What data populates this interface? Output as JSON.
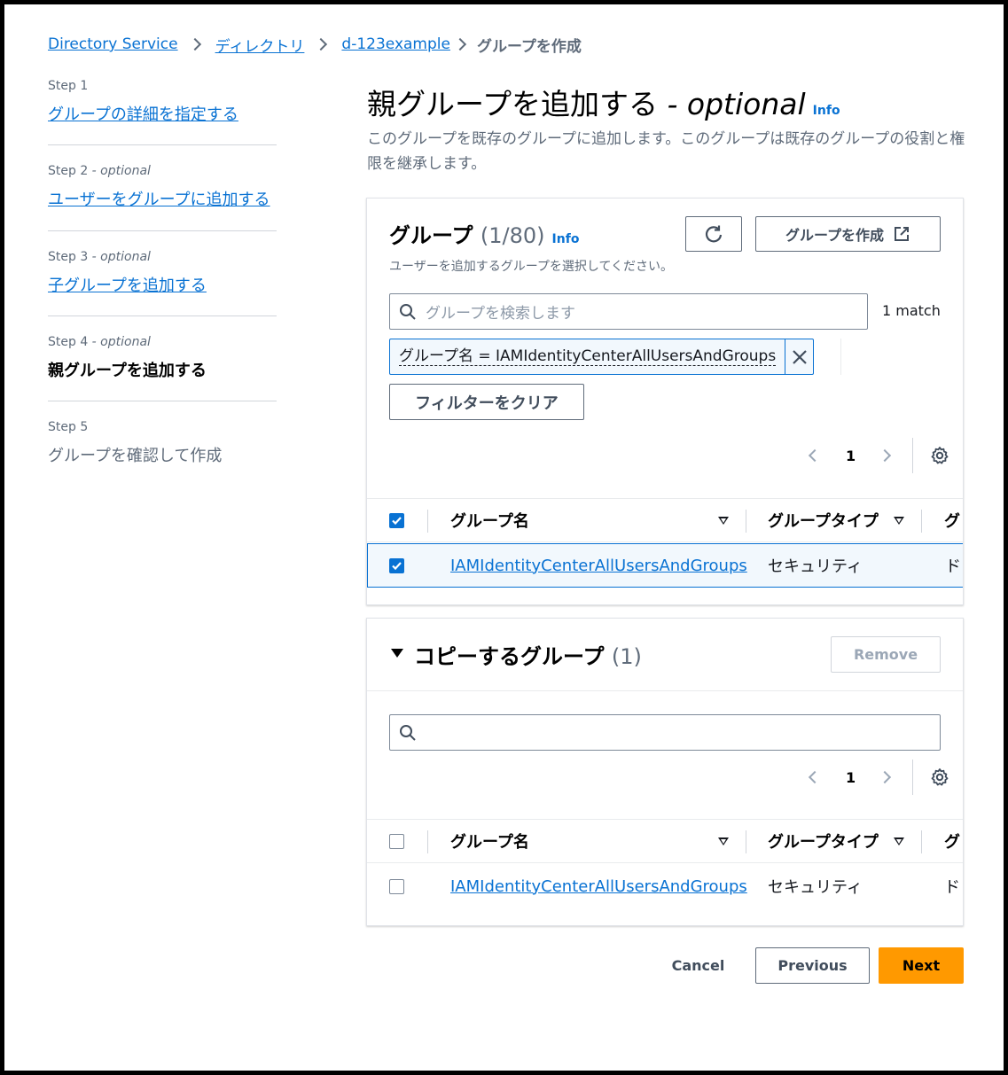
{
  "breadcrumb": [
    "Directory Service",
    "ディレクトリ",
    "d-123example",
    "グループを作成"
  ],
  "steps": [
    {
      "label": "Step 1",
      "optional": "",
      "text": "グループの詳細を指定する"
    },
    {
      "label": "Step 2",
      "optional": " - optional",
      "text": "ユーザーをグループに追加する"
    },
    {
      "label": "Step 3",
      "optional": " - optional",
      "text": "子グループを追加する"
    },
    {
      "label": "Step 4",
      "optional": " - optional",
      "text": "親グループを追加する"
    },
    {
      "label": "Step 5",
      "optional": "",
      "text": "グループを確認して作成"
    }
  ],
  "page": {
    "title": "親グループを追加する",
    "title_suffix": " - optional",
    "info": "Info",
    "description": "このグループを既存のグループに追加します。このグループは既存のグループの役割と権限を継承します。"
  },
  "groups_panel": {
    "title": "グループ",
    "count": "(1/80)",
    "info": "Info",
    "subtitle": "ユーザーを追加するグループを選択してください。",
    "create_button": "グループを作成",
    "search_placeholder": "グループを検索します",
    "match_count": "1 match",
    "filter_token": "グループ名 = IAMIdentityCenterAllUsersAndGroups",
    "clear_filter": "フィルターをクリア",
    "page": "1",
    "columns": [
      "グループ名",
      "グループタイプ",
      "グ"
    ],
    "rows": [
      {
        "name": "IAMIdentityCenterAllUsersAndGroups",
        "type": "セキュリティ",
        "extra": "ド",
        "checked": true
      }
    ]
  },
  "copy_panel": {
    "title": "コピーするグループ",
    "count": "(1)",
    "remove_button": "Remove",
    "search_placeholder": "",
    "page": "1",
    "columns": [
      "グループ名",
      "グループタイプ",
      "グ"
    ],
    "rows": [
      {
        "name": "IAMIdentityCenterAllUsersAndGroups",
        "type": "セキュリティ",
        "extra": "ド",
        "checked": false
      }
    ]
  },
  "footer": {
    "cancel": "Cancel",
    "previous": "Previous",
    "next": "Next"
  },
  "colors": {
    "link": "#0972d3",
    "primary": "#ff9900",
    "muted": "#5f6b7a"
  }
}
